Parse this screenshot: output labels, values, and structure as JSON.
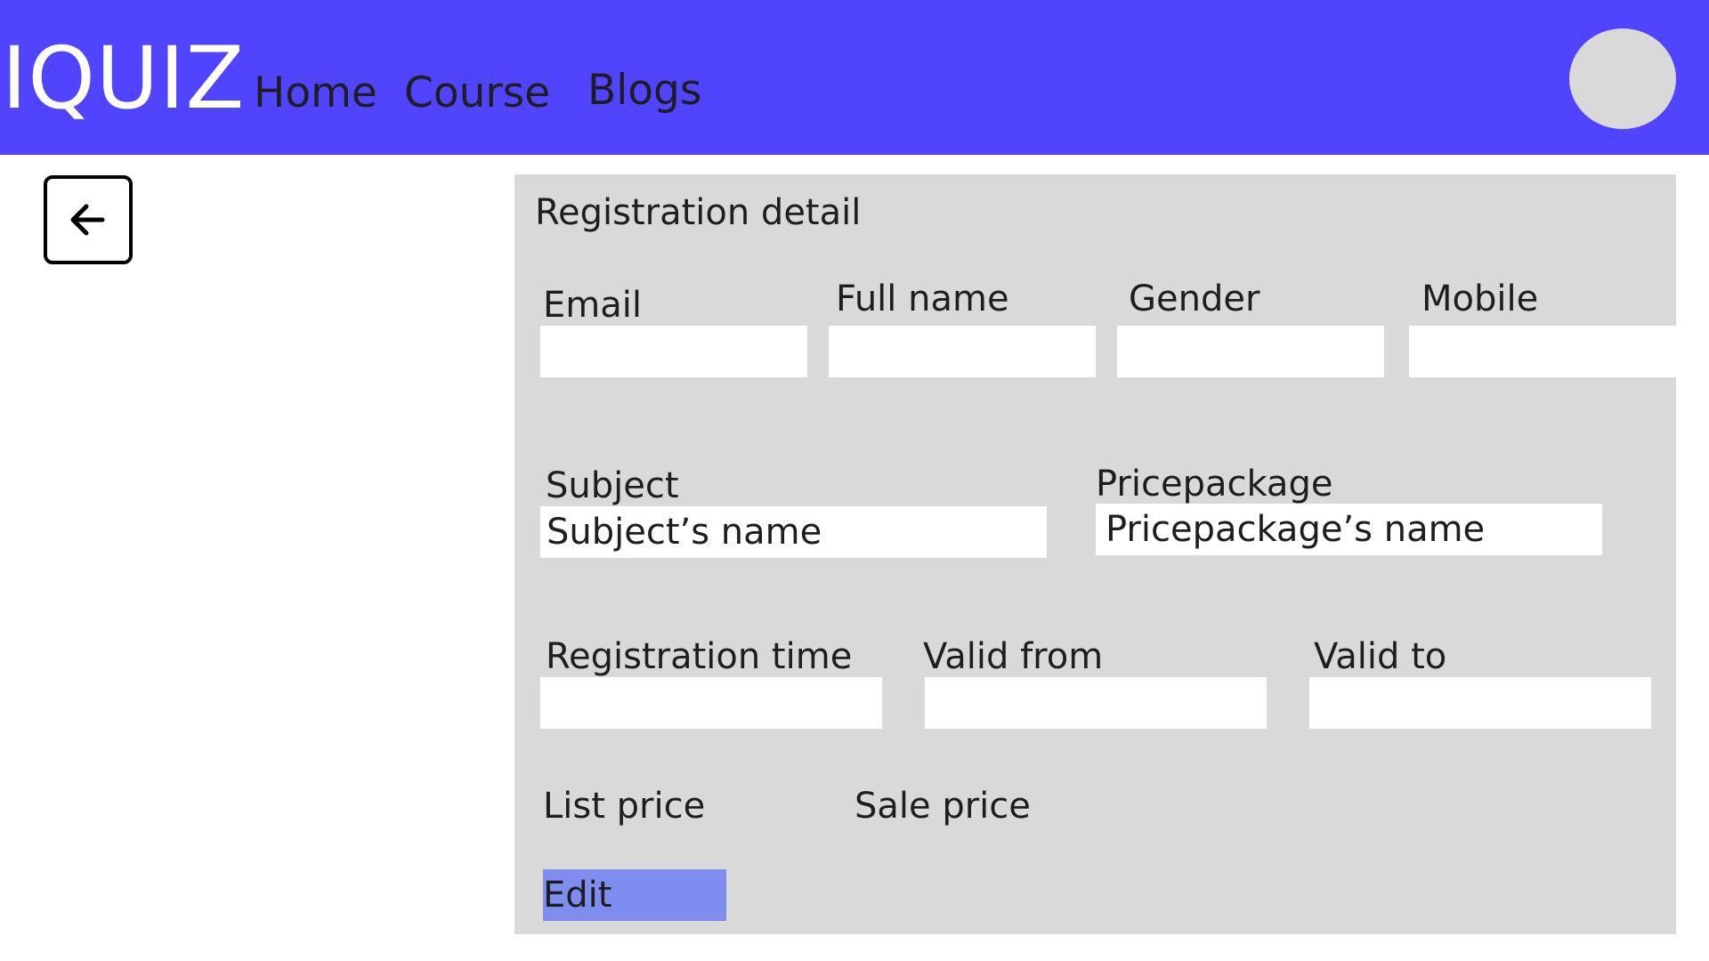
{
  "header": {
    "logo": "IQUIZ",
    "nav": [
      "Home",
      "Course",
      "Blogs"
    ]
  },
  "icons": {
    "back": "arrow-left-icon",
    "avatar": "user-avatar"
  },
  "panel": {
    "title": "Registration detail",
    "email": {
      "label": "Email",
      "value": ""
    },
    "full_name": {
      "label": "Full name",
      "value": ""
    },
    "gender": {
      "label": "Gender",
      "value": ""
    },
    "mobile": {
      "label": "Mobile",
      "value": ""
    },
    "subject": {
      "label": "Subject",
      "value": "Subject’s name"
    },
    "pricepackage": {
      "label": "Pricepackage",
      "value": "Pricepackage’s name"
    },
    "registration_time": {
      "label": "Registration time",
      "value": ""
    },
    "valid_from": {
      "label": "Valid from",
      "value": ""
    },
    "valid_to": {
      "label": "Valid to",
      "value": ""
    },
    "list_price": {
      "label": "List price"
    },
    "sale_price": {
      "label": "Sale price"
    },
    "edit_label": "Edit"
  },
  "colors": {
    "header_bg": "#5044ff",
    "panel_bg": "#d9d9d9",
    "edit_button_bg": "#7f8cf0",
    "avatar_bg": "#d9d9d9"
  }
}
